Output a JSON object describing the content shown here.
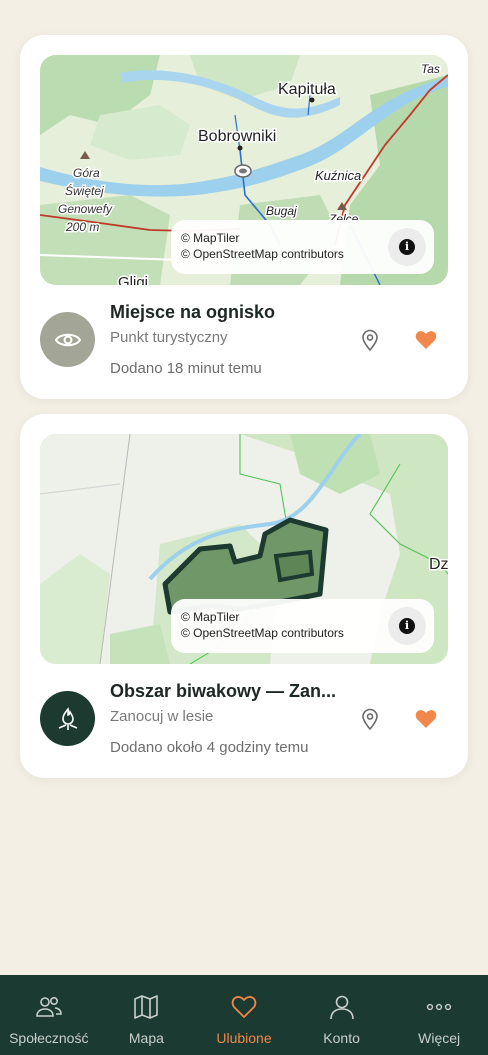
{
  "colors": {
    "background": "#f3efe4",
    "card": "#ffffff",
    "tabbar": "#1b3a31",
    "accent": "#f2874a",
    "heart": "#f2874a",
    "avatar_gray": "#a3a596",
    "avatar_dark": "#1c3a30"
  },
  "cards": [
    {
      "map": {
        "labels": {
          "kapitula": "Kapituła",
          "tas": "Tas",
          "bobrowniki": "Bobrowniki",
          "kuznica": "Kuźnica",
          "gora1": "Góra",
          "gora2": "Świętej",
          "gora3": "Genowefy",
          "gora4": "200 m",
          "bugaj": "Bugaj",
          "zelce": "Zelce",
          "gligi": "Gligi"
        },
        "attribution": [
          "© MapTiler",
          "© OpenStreetMap contributors"
        ],
        "info_icon": "info-icon"
      },
      "avatar_icon": "eye-icon",
      "title": "Miejsce na ognisko",
      "subtitle": "Punkt turystyczny",
      "added": "Dodano 18 minut temu",
      "pin_icon": "map-pin-icon",
      "favorite_icon": "heart-filled-icon"
    },
    {
      "map": {
        "labels": {
          "dz": "Dz"
        },
        "attribution": [
          "© MapTiler",
          "© OpenStreetMap contributors"
        ],
        "info_icon": "info-icon"
      },
      "avatar_icon": "campfire-icon",
      "title": "Obszar biwakowy — Zan...",
      "subtitle": "Zanocuj w lesie",
      "added": "Dodano około 4 godziny temu",
      "pin_icon": "map-pin-icon",
      "favorite_icon": "heart-filled-icon"
    }
  ],
  "tabbar": {
    "active": "Ulubione",
    "items": [
      {
        "label": "Społeczność",
        "icon": "users-icon"
      },
      {
        "label": "Mapa",
        "icon": "map-icon"
      },
      {
        "label": "Ulubione",
        "icon": "heart-icon"
      },
      {
        "label": "Konto",
        "icon": "user-icon"
      },
      {
        "label": "Więcej",
        "icon": "more-icon"
      }
    ]
  }
}
